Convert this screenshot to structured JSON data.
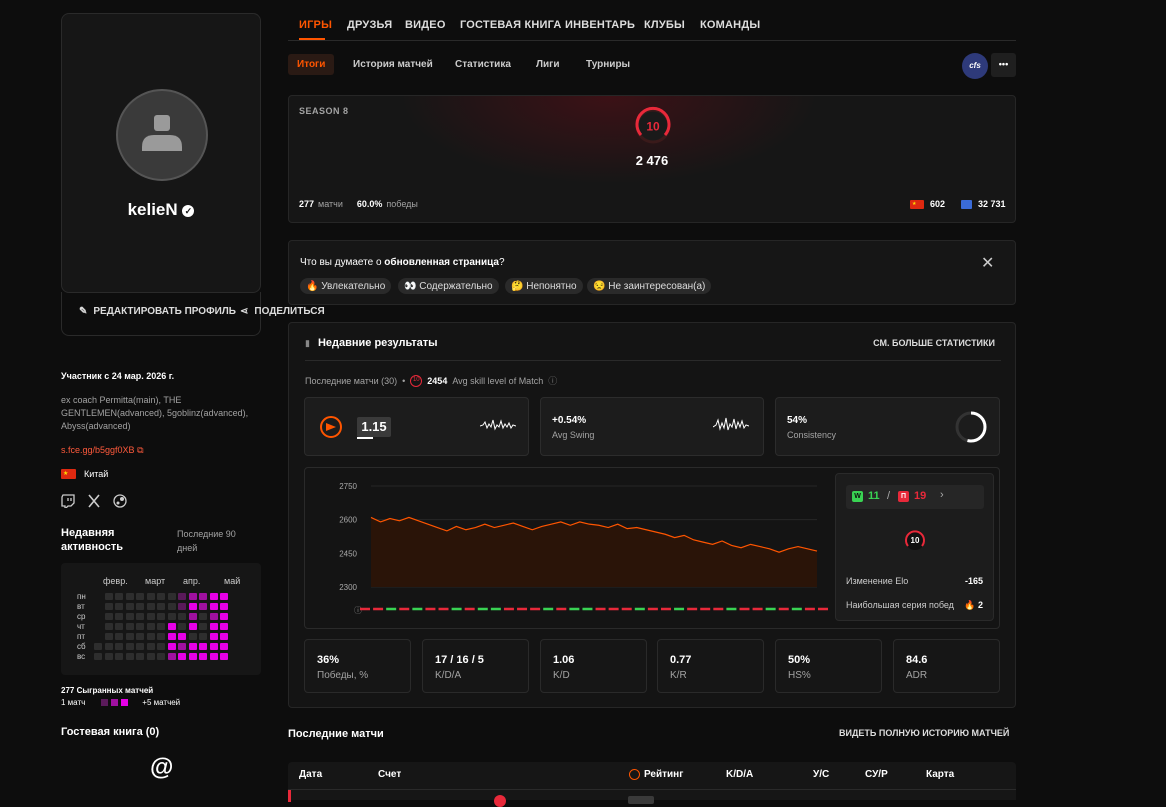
{
  "profile": {
    "username": "kelieN",
    "edit_label": "РЕДАКТИРОВАТЬ ПРОФИЛЬ",
    "share_label": "ПОДЕЛИТЬСЯ",
    "member_since": "Участник с 24 мар. 2026 г.",
    "bio": "ex coach Permitta(main), THE GENTLEMEN(advanced), 5goblinz(advanced), Abyss(advanced)",
    "link": "s.fce.gg/b5ggf0XB",
    "country": "Китай",
    "social": [
      "twitch-icon",
      "x-icon",
      "steam-icon"
    ]
  },
  "activity": {
    "title": "Недавняя активность",
    "period": "Последние 90 дней",
    "months": [
      "февр.",
      "март",
      "апр.",
      "май"
    ],
    "days": [
      "пн",
      "вт",
      "ср",
      "чт",
      "пт",
      "сб",
      "вс"
    ],
    "matches_played": "277 Сыгранных матчей",
    "legend_low": "1 матч",
    "legend_high": "+5 матчей"
  },
  "guestbook": {
    "title": "Гостевая книга (0)",
    "icon": "at-icon"
  },
  "nav": {
    "tabs": [
      "ИГРЫ",
      "ДРУЗЬЯ",
      "ВИДЕО",
      "ГОСТЕВАЯ КНИГА",
      "ИНВЕНТАРЬ",
      "КЛУБЫ",
      "КОМАНДЫ"
    ],
    "subtabs": [
      "Итоги",
      "История матчей",
      "Статистика",
      "Лиги",
      "Турниры"
    ],
    "game_badge": "cfs",
    "more": "•••"
  },
  "season": {
    "title": "SEASON 8",
    "level": "10",
    "elo": "2 476",
    "matches_count": "277",
    "matches_label": "матчи",
    "winrate": "60.0%",
    "winrate_label": "победы",
    "country_rank": "602",
    "region_rank": "32 731"
  },
  "poll": {
    "question_prefix": "Что вы думаете о ",
    "question_bold": "обновленная страница",
    "question_suffix": "?",
    "options": [
      "🔥 Увлекательно",
      "👀 Содержательно",
      "🤔 Непонятно",
      "😒 Не заинтересован(а)"
    ]
  },
  "recent": {
    "title": "Недавние результаты",
    "more_stats": "СМ. БОЛЬШЕ СТАТИСТИКИ",
    "last_matches": "Последние матчи (30)",
    "dot": "•",
    "level": "10",
    "avg_skill": "2454",
    "avg_skill_label": "Avg skill level of Match",
    "info_icon": "info-icon"
  },
  "metrics": [
    {
      "value": "1.15",
      "label": ""
    },
    {
      "value": "+0.54%",
      "label": "Avg Swing"
    },
    {
      "value": "54%",
      "label": "Consistency",
      "fraction": 0.54
    }
  ],
  "chart_data": {
    "type": "line",
    "y_ticks": [
      2750,
      2600,
      2450,
      2300
    ],
    "ylim": [
      2300,
      2750
    ],
    "values": [
      2610,
      2590,
      2605,
      2595,
      2610,
      2595,
      2580,
      2565,
      2550,
      2570,
      2555,
      2565,
      2580,
      2565,
      2575,
      2585,
      2570,
      2555,
      2570,
      2580,
      2590,
      2575,
      2590,
      2580,
      2575,
      2565,
      2580,
      2560,
      2565,
      2555,
      2545,
      2535,
      2520,
      2530,
      2510,
      2500,
      2490,
      2505,
      2485,
      2475,
      2490,
      2480,
      2470,
      2455,
      2470,
      2480,
      2470,
      2460
    ],
    "results": [
      0,
      0,
      1,
      0,
      1,
      0,
      0,
      1,
      0,
      1,
      1,
      0,
      0,
      0,
      1,
      0,
      1,
      1,
      0,
      0,
      0,
      1,
      0,
      0,
      1,
      0,
      0,
      0,
      1,
      0,
      0,
      1,
      0,
      1,
      0,
      0
    ]
  },
  "elo_summary": {
    "wins_label": "W",
    "wins": "11",
    "sep": "/",
    "losses_label": "П",
    "losses": "19",
    "level": "10",
    "elo_change_label": "Изменение Elo",
    "elo_change": "-165",
    "streak_label": "Наибольшая серия побед",
    "streak": "2"
  },
  "stats": [
    {
      "value": "36%",
      "label": "Победы, %"
    },
    {
      "value": "17 / 16 / 5",
      "label": "K/D/A"
    },
    {
      "value": "1.06",
      "label": "K/D"
    },
    {
      "value": "0.77",
      "label": "K/R"
    },
    {
      "value": "50%",
      "label": "HS%"
    },
    {
      "value": "84.6",
      "label": "ADR"
    }
  ],
  "last_matches": {
    "title": "Последние матчи",
    "full_history": "ВИДЕТЬ ПОЛНУЮ ИСТОРИЮ МАТЧЕЙ",
    "columns": [
      "Дата",
      "Счет",
      "Рейтинг",
      "K/D/A",
      "У/С",
      "СУ/Р",
      "Карта"
    ]
  },
  "colors": {
    "accent": "#ff5500",
    "win": "#39d353",
    "loss": "#e8293a",
    "heat": "#e600e6"
  }
}
